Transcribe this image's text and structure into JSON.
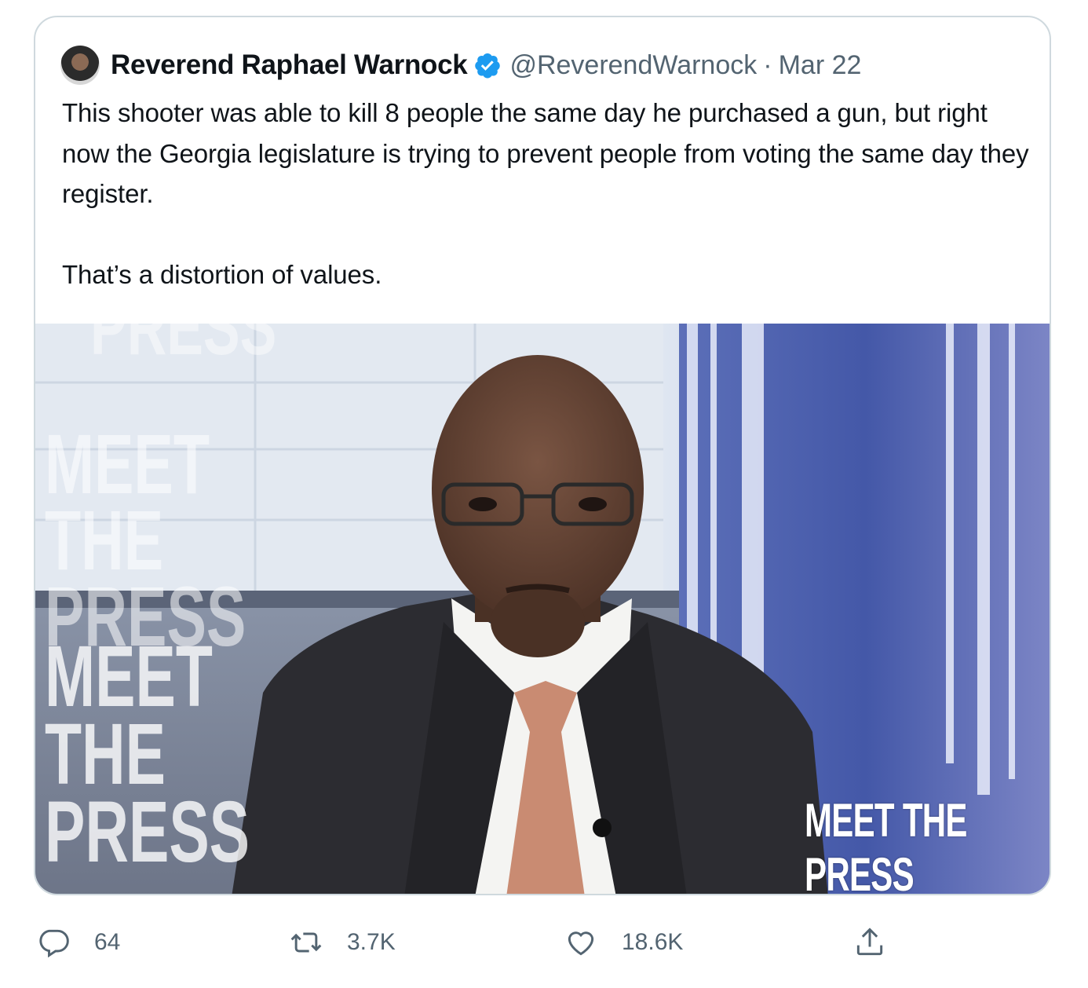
{
  "tweet": {
    "author_name": "Reverend Raphael Warnock",
    "handle": "@ReverendWarnock",
    "separator": "·",
    "date": "Mar 22",
    "text_paragraph_1": "This shooter was able to kill 8 people the same day he purchased a gun, but right now the Georgia legislature is trying to prevent people from voting the same day they register.",
    "text_paragraph_2": "That’s a distortion of values."
  },
  "media": {
    "watermark_top": "PRESS",
    "watermark_1": "MEET THE PRESS",
    "watermark_2": "MEET THE PRESS",
    "logo": "MEET THE PRESS"
  },
  "actions": {
    "reply_count": "64",
    "retweet_count": "3.7K",
    "like_count": "18.6K"
  },
  "icons": {
    "verified": "verified-badge-icon",
    "reply": "reply-icon",
    "retweet": "retweet-icon",
    "like": "heart-icon",
    "share": "share-icon"
  },
  "colors": {
    "verified_blue": "#1d9bf0",
    "secondary_text": "#536471",
    "border": "#cfd9de"
  }
}
